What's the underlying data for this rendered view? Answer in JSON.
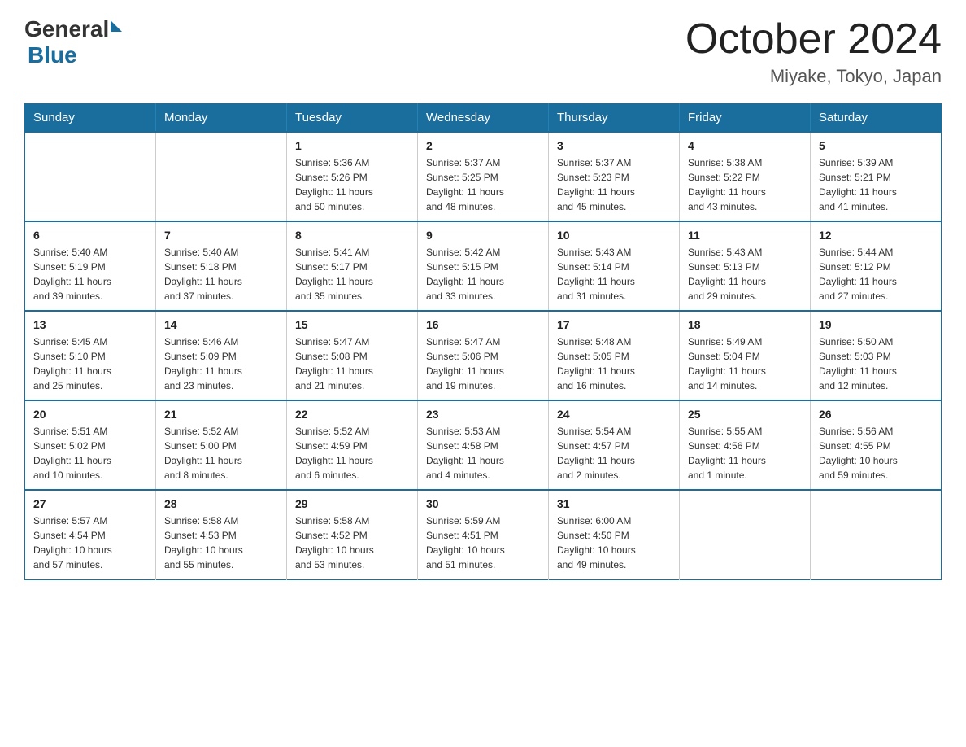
{
  "header": {
    "logo_general": "General",
    "logo_blue": "Blue",
    "title": "October 2024",
    "subtitle": "Miyake, Tokyo, Japan"
  },
  "calendar": {
    "days_of_week": [
      "Sunday",
      "Monday",
      "Tuesday",
      "Wednesday",
      "Thursday",
      "Friday",
      "Saturday"
    ],
    "weeks": [
      [
        {
          "day": "",
          "info": ""
        },
        {
          "day": "",
          "info": ""
        },
        {
          "day": "1",
          "info": "Sunrise: 5:36 AM\nSunset: 5:26 PM\nDaylight: 11 hours\nand 50 minutes."
        },
        {
          "day": "2",
          "info": "Sunrise: 5:37 AM\nSunset: 5:25 PM\nDaylight: 11 hours\nand 48 minutes."
        },
        {
          "day": "3",
          "info": "Sunrise: 5:37 AM\nSunset: 5:23 PM\nDaylight: 11 hours\nand 45 minutes."
        },
        {
          "day": "4",
          "info": "Sunrise: 5:38 AM\nSunset: 5:22 PM\nDaylight: 11 hours\nand 43 minutes."
        },
        {
          "day": "5",
          "info": "Sunrise: 5:39 AM\nSunset: 5:21 PM\nDaylight: 11 hours\nand 41 minutes."
        }
      ],
      [
        {
          "day": "6",
          "info": "Sunrise: 5:40 AM\nSunset: 5:19 PM\nDaylight: 11 hours\nand 39 minutes."
        },
        {
          "day": "7",
          "info": "Sunrise: 5:40 AM\nSunset: 5:18 PM\nDaylight: 11 hours\nand 37 minutes."
        },
        {
          "day": "8",
          "info": "Sunrise: 5:41 AM\nSunset: 5:17 PM\nDaylight: 11 hours\nand 35 minutes."
        },
        {
          "day": "9",
          "info": "Sunrise: 5:42 AM\nSunset: 5:15 PM\nDaylight: 11 hours\nand 33 minutes."
        },
        {
          "day": "10",
          "info": "Sunrise: 5:43 AM\nSunset: 5:14 PM\nDaylight: 11 hours\nand 31 minutes."
        },
        {
          "day": "11",
          "info": "Sunrise: 5:43 AM\nSunset: 5:13 PM\nDaylight: 11 hours\nand 29 minutes."
        },
        {
          "day": "12",
          "info": "Sunrise: 5:44 AM\nSunset: 5:12 PM\nDaylight: 11 hours\nand 27 minutes."
        }
      ],
      [
        {
          "day": "13",
          "info": "Sunrise: 5:45 AM\nSunset: 5:10 PM\nDaylight: 11 hours\nand 25 minutes."
        },
        {
          "day": "14",
          "info": "Sunrise: 5:46 AM\nSunset: 5:09 PM\nDaylight: 11 hours\nand 23 minutes."
        },
        {
          "day": "15",
          "info": "Sunrise: 5:47 AM\nSunset: 5:08 PM\nDaylight: 11 hours\nand 21 minutes."
        },
        {
          "day": "16",
          "info": "Sunrise: 5:47 AM\nSunset: 5:06 PM\nDaylight: 11 hours\nand 19 minutes."
        },
        {
          "day": "17",
          "info": "Sunrise: 5:48 AM\nSunset: 5:05 PM\nDaylight: 11 hours\nand 16 minutes."
        },
        {
          "day": "18",
          "info": "Sunrise: 5:49 AM\nSunset: 5:04 PM\nDaylight: 11 hours\nand 14 minutes."
        },
        {
          "day": "19",
          "info": "Sunrise: 5:50 AM\nSunset: 5:03 PM\nDaylight: 11 hours\nand 12 minutes."
        }
      ],
      [
        {
          "day": "20",
          "info": "Sunrise: 5:51 AM\nSunset: 5:02 PM\nDaylight: 11 hours\nand 10 minutes."
        },
        {
          "day": "21",
          "info": "Sunrise: 5:52 AM\nSunset: 5:00 PM\nDaylight: 11 hours\nand 8 minutes."
        },
        {
          "day": "22",
          "info": "Sunrise: 5:52 AM\nSunset: 4:59 PM\nDaylight: 11 hours\nand 6 minutes."
        },
        {
          "day": "23",
          "info": "Sunrise: 5:53 AM\nSunset: 4:58 PM\nDaylight: 11 hours\nand 4 minutes."
        },
        {
          "day": "24",
          "info": "Sunrise: 5:54 AM\nSunset: 4:57 PM\nDaylight: 11 hours\nand 2 minutes."
        },
        {
          "day": "25",
          "info": "Sunrise: 5:55 AM\nSunset: 4:56 PM\nDaylight: 11 hours\nand 1 minute."
        },
        {
          "day": "26",
          "info": "Sunrise: 5:56 AM\nSunset: 4:55 PM\nDaylight: 10 hours\nand 59 minutes."
        }
      ],
      [
        {
          "day": "27",
          "info": "Sunrise: 5:57 AM\nSunset: 4:54 PM\nDaylight: 10 hours\nand 57 minutes."
        },
        {
          "day": "28",
          "info": "Sunrise: 5:58 AM\nSunset: 4:53 PM\nDaylight: 10 hours\nand 55 minutes."
        },
        {
          "day": "29",
          "info": "Sunrise: 5:58 AM\nSunset: 4:52 PM\nDaylight: 10 hours\nand 53 minutes."
        },
        {
          "day": "30",
          "info": "Sunrise: 5:59 AM\nSunset: 4:51 PM\nDaylight: 10 hours\nand 51 minutes."
        },
        {
          "day": "31",
          "info": "Sunrise: 6:00 AM\nSunset: 4:50 PM\nDaylight: 10 hours\nand 49 minutes."
        },
        {
          "day": "",
          "info": ""
        },
        {
          "day": "",
          "info": ""
        }
      ]
    ]
  }
}
